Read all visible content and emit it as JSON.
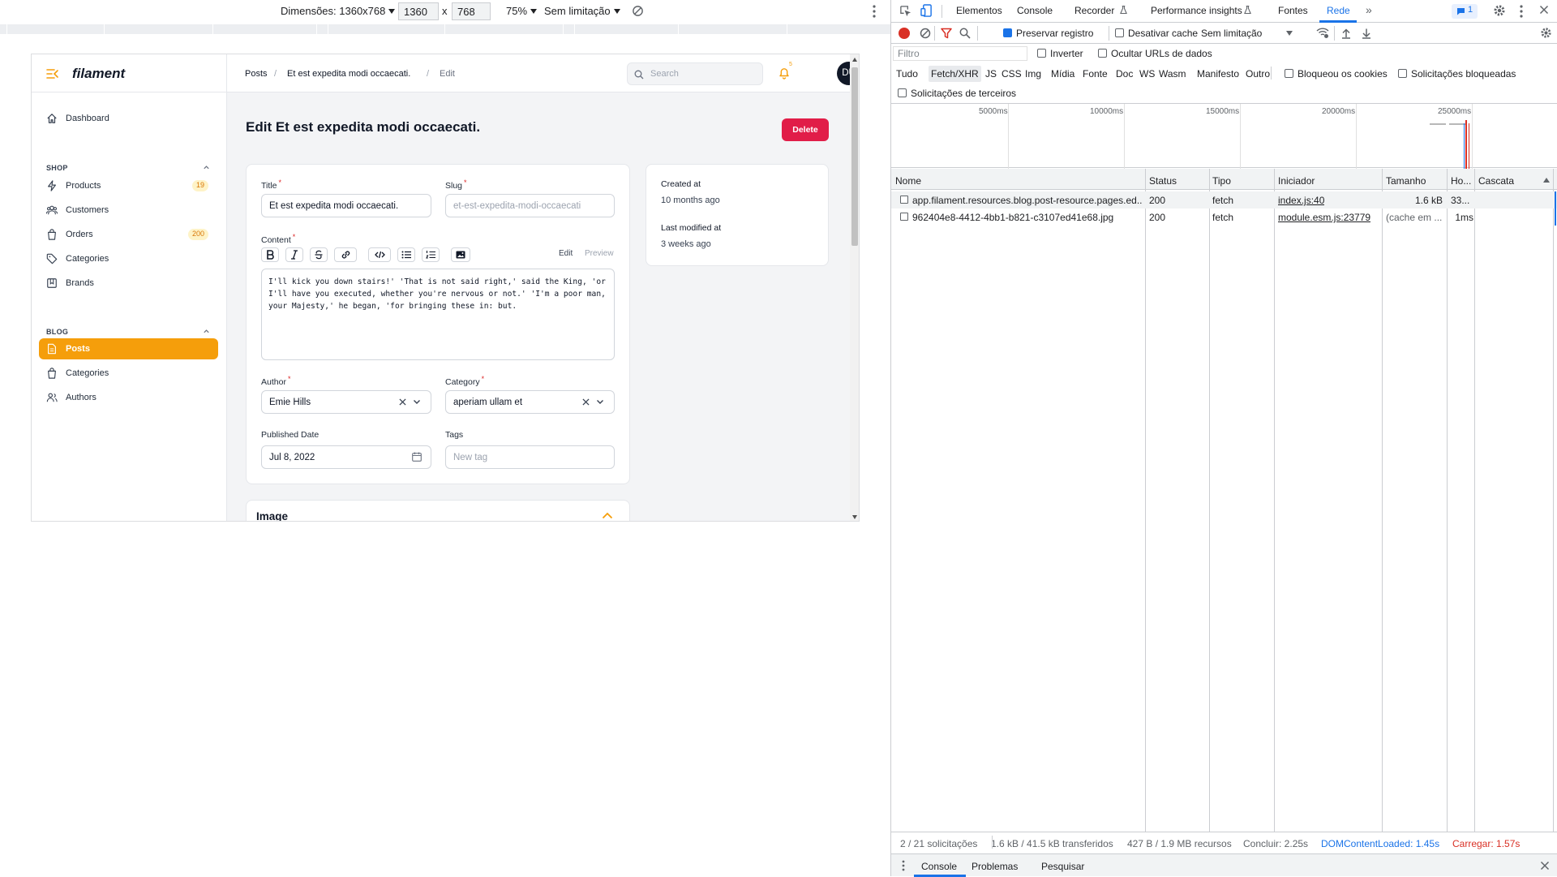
{
  "device_toolbar": {
    "dimensions_label": "Dimensões: 1360x768",
    "width_value": "1360",
    "times": "x",
    "height_value": "768",
    "zoom": "75%",
    "throttle": "Sem limitação"
  },
  "app": {
    "brand": "filament",
    "nav": {
      "dashboard": "Dashboard",
      "shop_group": "SHOP",
      "shop_items": [
        {
          "label": "Products",
          "badge": "19"
        },
        {
          "label": "Customers",
          "badge": ""
        },
        {
          "label": "Orders",
          "badge": "200"
        },
        {
          "label": "Categories",
          "badge": ""
        },
        {
          "label": "Brands",
          "badge": ""
        }
      ],
      "blog_group": "BLOG",
      "blog_items": [
        {
          "label": "Posts"
        },
        {
          "label": "Categories"
        },
        {
          "label": "Authors"
        }
      ]
    },
    "breadcrumbs": [
      "Posts",
      "Et est expedita modi occaecati.",
      "Edit"
    ],
    "search_placeholder": "Search",
    "notification_count": "5",
    "avatar_initials": "DU",
    "page_title": "Edit Et est expedita modi occaecati.",
    "delete_label": "Delete",
    "form": {
      "title_label": "Title",
      "title_value": "Et est expedita modi occaecati.",
      "slug_label": "Slug",
      "slug_value": "et-est-expedita-modi-occaecati",
      "content_label": "Content",
      "editor_edit": "Edit",
      "editor_preview": "Preview",
      "content_value": "I'll kick you down stairs!' 'That is not said right,' said the King, 'or I'll have you executed, whether you're nervous or not.' 'I'm a poor man, your Majesty,' he began, 'for bringing these in: but.",
      "author_label": "Author",
      "author_value": "Emie Hills",
      "category_label": "Category",
      "category_value": "aperiam ullam et",
      "published_label": "Published Date",
      "published_value": "Jul 8, 2022",
      "tags_label": "Tags",
      "tags_placeholder": "New tag",
      "required_mark": "*"
    },
    "meta": {
      "created_label": "Created at",
      "created_value": "10 months ago",
      "modified_label": "Last modified at",
      "modified_value": "3 weeks ago"
    },
    "image_section": "Image"
  },
  "devtools": {
    "tabs": [
      "Elementos",
      "Console",
      "Recorder",
      "Performance insights",
      "Fontes",
      "Rede"
    ],
    "active_tab": "Rede",
    "issues_count": "1",
    "preserve_log": "Preservar registro",
    "disable_cache": "Desativar cache",
    "throttle": "Sem limitação",
    "filter_placeholder": "Filtro",
    "invert": "Inverter",
    "hide_data_urls": "Ocultar URLs de dados",
    "type_filters": [
      "Tudo",
      "Fetch/XHR",
      "JS",
      "CSS",
      "Img",
      "Mídia",
      "Fonte",
      "Doc",
      "WS",
      "Wasm",
      "Manifesto",
      "Outro"
    ],
    "blocked_cookies": "Bloqueou os cookies",
    "blocked_requests": "Solicitações bloqueadas",
    "third_party": "Solicitações de terceiros",
    "timeline_ticks": [
      "5000ms",
      "10000ms",
      "15000ms",
      "20000ms",
      "25000ms"
    ],
    "columns": [
      "Nome",
      "Status",
      "Tipo",
      "Iniciador",
      "Tamanho",
      "Ho...",
      "Cascata"
    ],
    "requests": [
      {
        "name": "app.filament.resources.blog.post-resource.pages.ed...",
        "status": "200",
        "type": "fetch",
        "initiator": "index.js:40",
        "size": "1.6 kB",
        "time": "33..."
      },
      {
        "name": "962404e8-4412-4bb1-b821-c3107ed41e68.jpg",
        "status": "200",
        "type": "fetch",
        "initiator": "module.esm.js:23779",
        "size": "(cache em ...",
        "time": "1ms"
      }
    ],
    "status_bar": {
      "requests": "2 / 21 solicitações",
      "transferred": "1.6 kB / 41.5 kB transferidos",
      "resources": "427 B / 1.9 MB recursos",
      "finish": "Concluir: 2.25s",
      "dcl": "DOMContentLoaded: 1.45s",
      "load": "Carregar: 1.57s"
    },
    "drawer_tabs": [
      "Console",
      "Problemas",
      "Pesquisar"
    ]
  },
  "colors": {
    "primary": "#f59e0b",
    "danger": "#e11d48",
    "devtools_blue": "#1a73e8",
    "dcl": "#1a73e8",
    "load": "#d93025"
  }
}
